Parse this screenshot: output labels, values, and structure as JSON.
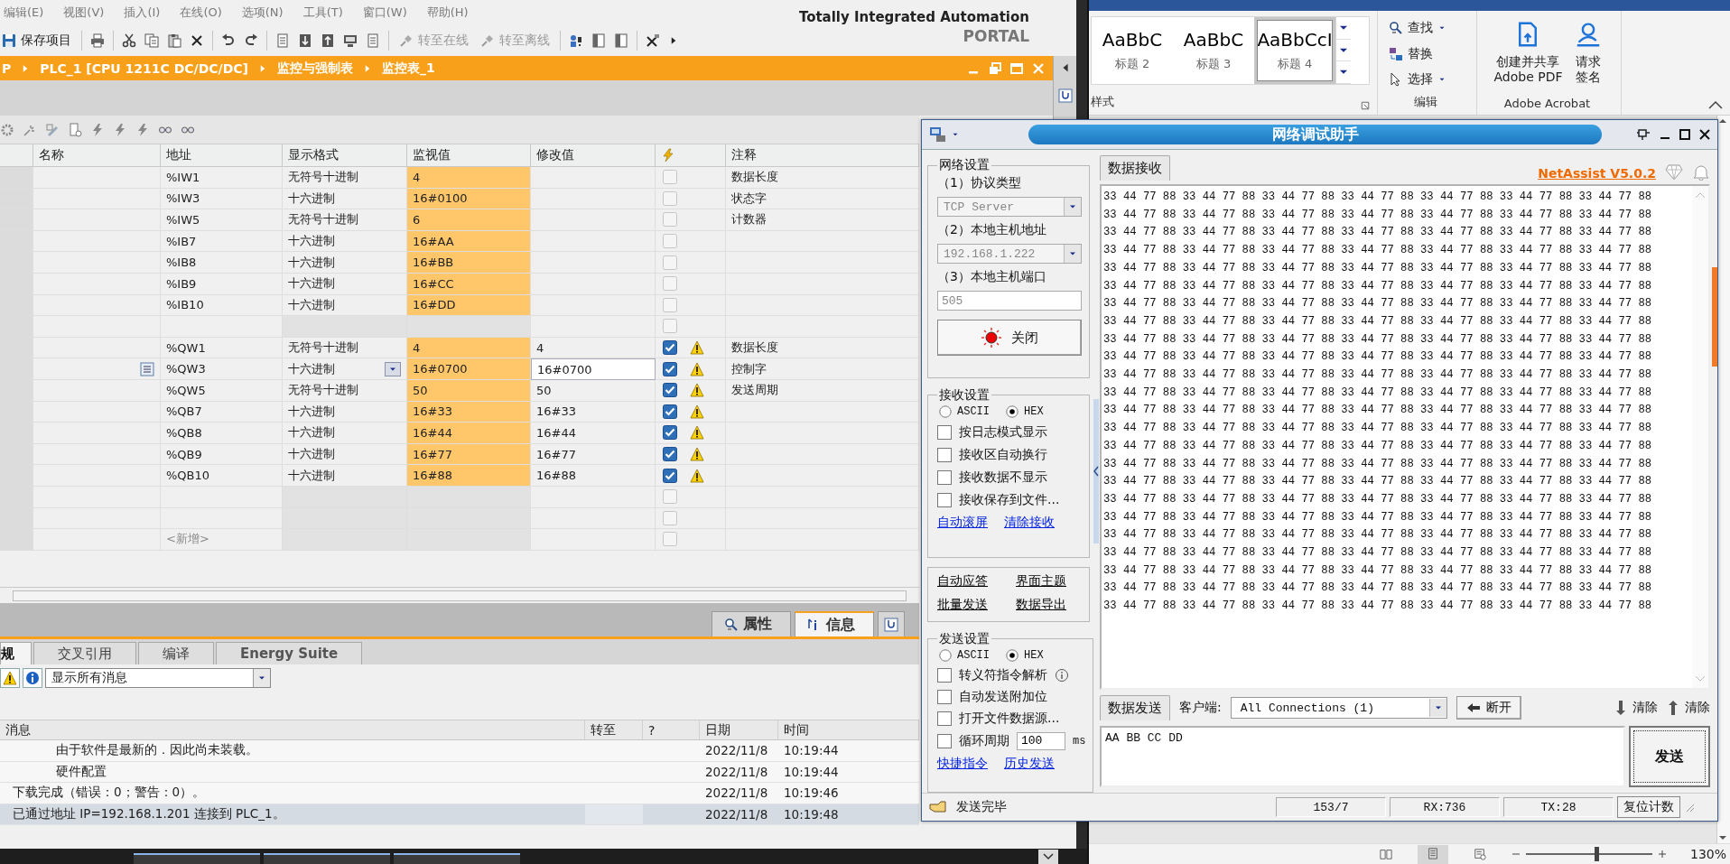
{
  "tia": {
    "menu": [
      "编辑(E)",
      "视图(V)",
      "插入(I)",
      "在线(O)",
      "选项(N)",
      "工具(T)",
      "窗口(W)",
      "帮助(H)"
    ],
    "brand": {
      "title": "Totally Integrated Automation",
      "subtitle": "PORTAL"
    },
    "toolbar_buttons": [
      {
        "label": "保存项目",
        "disabled": false
      },
      {
        "label": "转至在线",
        "disabled": true
      },
      {
        "label": "转至离线",
        "disabled": true
      }
    ],
    "breadcrumb": [
      "P",
      "PLC_1 [CPU 1211C DC/DC/DC]",
      "监控与强制表",
      "监控表_1"
    ],
    "watch_table": {
      "columns": [
        "名称",
        "地址",
        "显示格式",
        "监视值",
        "修改值",
        "注释"
      ],
      "rows": [
        {
          "address": "%IW1",
          "format": "无符号十进制",
          "monitor": "4",
          "comment": "数据长度",
          "force": false,
          "warning": false,
          "editing": false
        },
        {
          "address": "%IW3",
          "format": "十六进制",
          "monitor": "16#0100",
          "comment": "状态字",
          "force": false,
          "warning": false,
          "editing": false
        },
        {
          "address": "%IW5",
          "format": "无符号十进制",
          "monitor": "6",
          "comment": "计数器",
          "force": false,
          "warning": false,
          "editing": false
        },
        {
          "address": "%IB7",
          "format": "十六进制",
          "monitor": "16#AA",
          "force": false,
          "warning": false,
          "editing": false
        },
        {
          "address": "%IB8",
          "format": "十六进制",
          "monitor": "16#BB",
          "force": false,
          "warning": false,
          "editing": false
        },
        {
          "address": "%IB9",
          "format": "十六进制",
          "monitor": "16#CC",
          "force": false,
          "warning": false,
          "editing": false
        },
        {
          "address": "%IB10",
          "format": "十六进制",
          "monitor": "16#DD",
          "force": false,
          "warning": false,
          "editing": false
        },
        {
          "force": false,
          "warning": false,
          "editing": false
        },
        {
          "address": "%QW1",
          "format": "无符号十进制",
          "monitor": "4",
          "modify": "4",
          "comment": "数据长度",
          "force": true,
          "warning": true,
          "editing": false
        },
        {
          "address": "%QW3",
          "format": "十六进制",
          "monitor": "16#0700",
          "modify": "16#0700",
          "comment": "控制字",
          "force": true,
          "warning": true,
          "editing": true
        },
        {
          "address": "%QW5",
          "format": "无符号十进制",
          "monitor": "50",
          "modify": "50",
          "comment": "发送周期",
          "force": true,
          "warning": true,
          "editing": false
        },
        {
          "address": "%QB7",
          "format": "十六进制",
          "monitor": "16#33",
          "modify": "16#33",
          "force": true,
          "warning": true,
          "editing": false
        },
        {
          "address": "%QB8",
          "format": "十六进制",
          "monitor": "16#44",
          "modify": "16#44",
          "force": true,
          "warning": true,
          "editing": false
        },
        {
          "address": "%QB9",
          "format": "十六进制",
          "monitor": "16#77",
          "modify": "16#77",
          "force": true,
          "warning": true,
          "editing": false
        },
        {
          "address": "%QB10",
          "format": "十六进制",
          "monitor": "16#88",
          "modify": "16#88",
          "force": true,
          "warning": true,
          "editing": false
        },
        {
          "force": false,
          "warning": false,
          "editing": false
        },
        {
          "force": false,
          "warning": false,
          "editing": false
        },
        {
          "kind": "add",
          "address": "<新增>",
          "force": false,
          "warning": false,
          "editing": false
        }
      ]
    },
    "panel_tabs": [
      {
        "label": "属性",
        "kind": "properties",
        "selected": false
      },
      {
        "label": "信息",
        "kind": "info",
        "selected": true
      },
      {
        "kind": "diagnostics",
        "selected": false
      }
    ],
    "inspector_tabs": [
      {
        "label": "规",
        "selected": true
      },
      {
        "label": "交叉引用",
        "selected": false
      },
      {
        "label": "编译",
        "selected": false
      },
      {
        "label": "Energy Suite",
        "selected": false
      }
    ],
    "filter": {
      "value": "显示所有消息"
    },
    "messages": {
      "columns": [
        "消息",
        "转至",
        "?",
        "日期",
        "时间"
      ],
      "rows": [
        {
          "kind": "detail",
          "text": "由于软件是最新的．因此尚未装载。",
          "date": "2022/11/8",
          "time": "10:19:44",
          "selected": false
        },
        {
          "kind": "detail",
          "text": "硬件配置",
          "date": "2022/11/8",
          "time": "10:19:44",
          "selected": false
        },
        {
          "kind": "summary",
          "text": "下载完成（错误：0；警告：0）。",
          "date": "2022/11/8",
          "time": "10:19:46",
          "selected": false
        },
        {
          "kind": "summary",
          "text": "已通过地址 IP=192.168.1.201 连接到 PLC_1。",
          "date": "2022/11/8",
          "time": "10:19:48",
          "selected": true
        }
      ]
    }
  },
  "word": {
    "styles": [
      {
        "sample": "AaBbC",
        "label": "标题 2",
        "selected": false
      },
      {
        "sample": "AaBbC",
        "label": "标题 3",
        "selected": false
      },
      {
        "sample": "AaBbCcI",
        "label": "标题 4",
        "selected": true
      }
    ],
    "styles_group": "样式",
    "edit": [
      {
        "label": "查找",
        "kind": "find"
      },
      {
        "label": "替换",
        "kind": "replace"
      },
      {
        "label": "选择",
        "kind": "select"
      }
    ],
    "edit_group": "编辑",
    "acrobat": [
      {
        "lines": [
          "创建并共享",
          "Adobe PDF"
        ],
        "kind": "pdf"
      },
      {
        "lines": [
          "请求",
          "签名"
        ],
        "kind": "sign"
      }
    ],
    "acrobat_group": "Adobe Acrobat",
    "zoom": {
      "level": 0.56,
      "reading": "130%"
    }
  },
  "netassist": {
    "title": "网络调试助手",
    "network": {
      "title": "网络设置",
      "protocol_label": "（1）协议类型",
      "protocol": "TCP Server",
      "host_label": "（2）本地主机地址",
      "host": "192.168.1.222",
      "port_label": "（3）本地主机端口",
      "port": "505",
      "button": "关闭"
    },
    "receive_settings": {
      "title": "接收设置",
      "modes": [
        {
          "label": "ASCII",
          "selected": false
        },
        {
          "label": "HEX",
          "selected": true
        }
      ],
      "options": [
        {
          "label": "按日志模式显示",
          "checked": false
        },
        {
          "label": "接收区自动换行",
          "checked": false
        },
        {
          "label": "接收数据不显示",
          "checked": false
        },
        {
          "label": "接收保存到文件...",
          "checked": false
        }
      ],
      "links": [
        "自动滚屏",
        "清除接收"
      ]
    },
    "extra_links": [
      "自动应答",
      "界面主题",
      "批量发送",
      "数据导出"
    ],
    "send_settings": {
      "title": "发送设置",
      "modes": [
        {
          "label": "ASCII",
          "selected": false
        },
        {
          "label": "HEX",
          "selected": true
        }
      ],
      "options": [
        {
          "kind": "info",
          "label": "转义符指令解析",
          "checked": false
        },
        {
          "kind": "check",
          "label": "自动发送附加位",
          "checked": false
        },
        {
          "kind": "check",
          "label": "打开文件数据源...",
          "checked": false
        },
        {
          "kind": "period",
          "label": "循环周期",
          "checked": false,
          "value": "100",
          "unit": "ms"
        }
      ],
      "links": [
        "快捷指令",
        "历史发送"
      ]
    },
    "receive": {
      "tab": "数据接收",
      "version": "NetAssist V5.0.2",
      "lines": [
        "33 44 77 88 33 44 77 88 33 44 77 88 33 44 77 88 33 44 77 88 33 44 77 88 33 44 77 88",
        "33 44 77 88 33 44 77 88 33 44 77 88 33 44 77 88 33 44 77 88 33 44 77 88 33 44 77 88",
        "33 44 77 88 33 44 77 88 33 44 77 88 33 44 77 88 33 44 77 88 33 44 77 88 33 44 77 88",
        "33 44 77 88 33 44 77 88 33 44 77 88 33 44 77 88 33 44 77 88 33 44 77 88 33 44 77 88",
        "33 44 77 88 33 44 77 88 33 44 77 88 33 44 77 88 33 44 77 88 33 44 77 88 33 44 77 88",
        "33 44 77 88 33 44 77 88 33 44 77 88 33 44 77 88 33 44 77 88 33 44 77 88 33 44 77 88",
        "33 44 77 88 33 44 77 88 33 44 77 88 33 44 77 88 33 44 77 88 33 44 77 88 33 44 77 88",
        "33 44 77 88 33 44 77 88 33 44 77 88 33 44 77 88 33 44 77 88 33 44 77 88 33 44 77 88",
        "33 44 77 88 33 44 77 88 33 44 77 88 33 44 77 88 33 44 77 88 33 44 77 88 33 44 77 88",
        "33 44 77 88 33 44 77 88 33 44 77 88 33 44 77 88 33 44 77 88 33 44 77 88 33 44 77 88",
        "33 44 77 88 33 44 77 88 33 44 77 88 33 44 77 88 33 44 77 88 33 44 77 88 33 44 77 88",
        "33 44 77 88 33 44 77 88 33 44 77 88 33 44 77 88 33 44 77 88 33 44 77 88 33 44 77 88",
        "33 44 77 88 33 44 77 88 33 44 77 88 33 44 77 88 33 44 77 88 33 44 77 88 33 44 77 88",
        "33 44 77 88 33 44 77 88 33 44 77 88 33 44 77 88 33 44 77 88 33 44 77 88 33 44 77 88",
        "33 44 77 88 33 44 77 88 33 44 77 88 33 44 77 88 33 44 77 88 33 44 77 88 33 44 77 88",
        "33 44 77 88 33 44 77 88 33 44 77 88 33 44 77 88 33 44 77 88 33 44 77 88 33 44 77 88",
        "33 44 77 88 33 44 77 88 33 44 77 88 33 44 77 88 33 44 77 88 33 44 77 88 33 44 77 88",
        "33 44 77 88 33 44 77 88 33 44 77 88 33 44 77 88 33 44 77 88 33 44 77 88 33 44 77 88",
        "33 44 77 88 33 44 77 88 33 44 77 88 33 44 77 88 33 44 77 88 33 44 77 88 33 44 77 88",
        "33 44 77 88 33 44 77 88 33 44 77 88 33 44 77 88 33 44 77 88 33 44 77 88 33 44 77 88",
        "33 44 77 88 33 44 77 88 33 44 77 88 33 44 77 88 33 44 77 88 33 44 77 88 33 44 77 88",
        "33 44 77 88 33 44 77 88 33 44 77 88 33 44 77 88 33 44 77 88 33 44 77 88 33 44 77 88",
        "33 44 77 88 33 44 77 88 33 44 77 88 33 44 77 88 33 44 77 88 33 44 77 88 33 44 77 88",
        "33 44 77 88 33 44 77 88 33 44 77 88 33 44 77 88 33 44 77 88 33 44 77 88 33 44 77 88"
      ]
    },
    "send": {
      "tab": "数据发送",
      "client_label": "客户端:",
      "client": "All Connections (1)",
      "disconnect": "断开",
      "clear": [
        "清除",
        "清除"
      ],
      "text": "AA BB CC DD",
      "button": "发送"
    },
    "status": {
      "message": "发送完毕",
      "fields": [
        "153/7",
        "RX:736",
        "TX:28"
      ],
      "reset": "复位计数"
    }
  }
}
